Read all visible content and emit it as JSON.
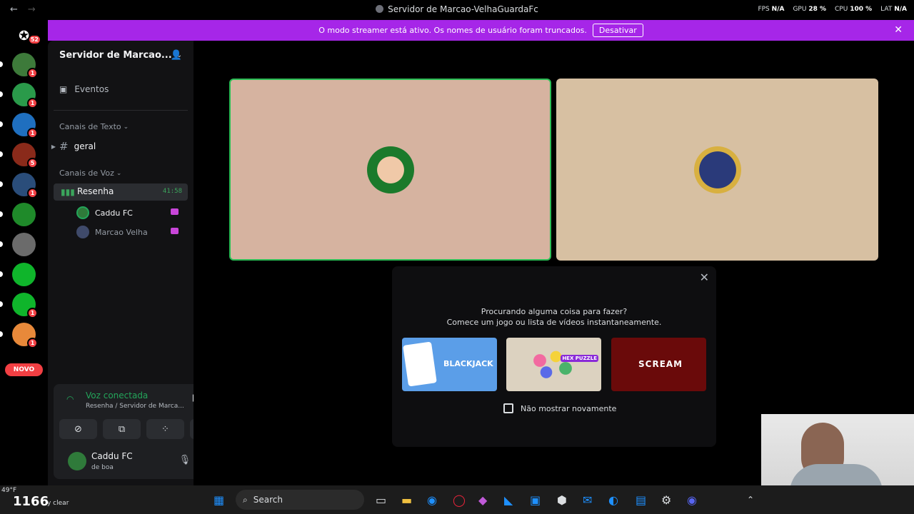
{
  "titlebar": {
    "title": "Servidor de Marcao-VelhaGuardaFc",
    "back": "←",
    "forward": "→",
    "stats": {
      "fps_label": "FPS",
      "fps": "N/A",
      "gpu_label": "GPU",
      "gpu": "28 %",
      "cpu_label": "CPU",
      "cpu": "100 %",
      "lat_label": "LAT",
      "lat": "N/A"
    }
  },
  "banner": {
    "text": "O modo streamer está ativo. Os nomes de usuário foram truncados.",
    "button": "Desativar",
    "close": "✕"
  },
  "rail": {
    "home_badge": "52",
    "servers": [
      {
        "badge": "1",
        "color": "#3d7a3a"
      },
      {
        "badge": "1",
        "color": "#2a9a4a"
      },
      {
        "badge": "1",
        "color": "#1f6fbf"
      },
      {
        "badge": "5",
        "color": "#8a2a1a"
      },
      {
        "badge": "1",
        "color": "#2a4d7a"
      },
      {
        "badge": "",
        "color": "#1f8a2a"
      },
      {
        "badge": "",
        "color": "#6b6b6b"
      },
      {
        "badge": "",
        "color": "#0fb52b"
      },
      {
        "badge": "1",
        "color": "#0fb52b"
      },
      {
        "badge": "1",
        "color": "#e8893a"
      }
    ],
    "novo": "NOVO"
  },
  "sidebar": {
    "server_name": "Servidor de Marcao...",
    "events": "Eventos",
    "text_category": "Canais de Texto",
    "text_channel": "geral",
    "voice_category": "Canais de Voz",
    "voice_channel": "Resenha",
    "voice_time": "41:58",
    "members": [
      {
        "name": "Caddu FC"
      },
      {
        "name": "Marcao Velha"
      }
    ]
  },
  "voice_panel": {
    "status": "Voz conectada",
    "sub": "Resenha / Servidor de Marca..."
  },
  "user_panel": {
    "name": "Caddu FC",
    "status": "de boa"
  },
  "activity": {
    "line1": "Procurando alguma coisa para fazer?",
    "line2": "Comece um jogo ou lista de vídeos instantaneamente.",
    "games": [
      "BLACKJACK",
      "HEX PUZZLE",
      "SCREAM"
    ],
    "checkbox_label": "Não mostrar novamente"
  },
  "taskbar": {
    "temp": "1166",
    "weather_top": "49°F",
    "weather_text": "y clear",
    "search": "Search"
  }
}
